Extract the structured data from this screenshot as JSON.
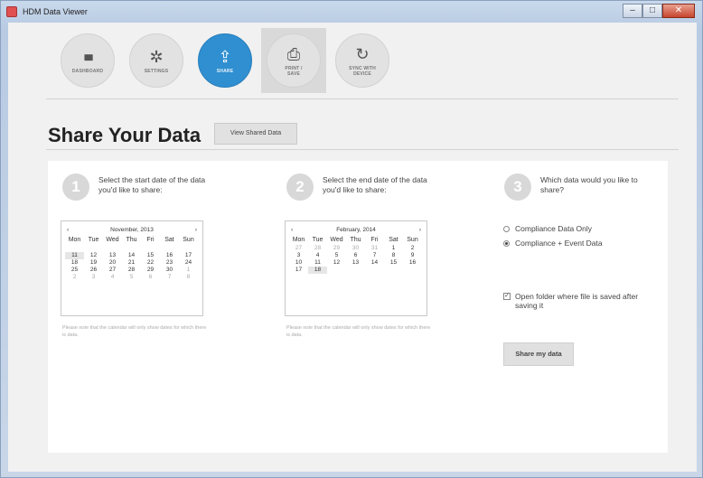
{
  "window": {
    "title": "HDM Data Viewer",
    "min": "–",
    "max": "□",
    "close": "✕"
  },
  "toolbar": {
    "items": [
      {
        "label": "DASHBOARD",
        "icon": "bar-chart-icon",
        "glyph": "▮▮▮"
      },
      {
        "label": "SETTINGS",
        "icon": "gear-icon",
        "glyph": "✲"
      },
      {
        "label": "SHARE",
        "icon": "upload-icon",
        "glyph": "⇪"
      },
      {
        "label": "PRINT / SAVE",
        "icon": "print-icon",
        "glyph": "⎙"
      },
      {
        "label": "SYNC WITH DEVICE",
        "icon": "sync-icon",
        "glyph": "↻"
      }
    ],
    "active_index": 2
  },
  "page": {
    "title": "Share Your Data",
    "view_shared_label": "View Shared Data"
  },
  "step1": {
    "number": "1",
    "text": "Select the start date of the data you'd like to share:"
  },
  "step2": {
    "number": "2",
    "text": "Select the end date of the data you'd like to share:"
  },
  "step3": {
    "number": "3",
    "text": "Which data would you like to share?"
  },
  "weekdays": [
    "Mon",
    "Tue",
    "Wed",
    "Thu",
    "Fri",
    "Sat",
    "Sun"
  ],
  "calendar1": {
    "month": "November, 2013",
    "prev": "‹",
    "next": "›",
    "rows": [
      [
        "",
        "",
        "",
        "",
        "",
        "",
        ""
      ],
      [
        "11",
        "12",
        "13",
        "14",
        "15",
        "16",
        "17"
      ],
      [
        "18",
        "19",
        "20",
        "21",
        "22",
        "23",
        "24"
      ],
      [
        "25",
        "26",
        "27",
        "28",
        "29",
        "30",
        "1"
      ],
      [
        "2",
        "3",
        "4",
        "5",
        "6",
        "7",
        "8"
      ]
    ],
    "selected": "11"
  },
  "calendar2": {
    "month": "February, 2014",
    "prev": "‹",
    "next": "›",
    "rows": [
      [
        "27",
        "28",
        "29",
        "30",
        "31",
        "1",
        "2"
      ],
      [
        "3",
        "4",
        "5",
        "6",
        "7",
        "8",
        "9"
      ],
      [
        "10",
        "11",
        "12",
        "13",
        "14",
        "15",
        "16"
      ],
      [
        "17",
        "18",
        "",
        "",
        "",
        "",
        ""
      ]
    ],
    "selected": "18"
  },
  "note": "Please note that the calendar will only show dates for which there is data.",
  "options": {
    "compliance_only": "Compliance Data Only",
    "compliance_event": "Compliance + Event Data",
    "selected": "compliance_event"
  },
  "open_folder": {
    "label": "Open folder where file is saved after saving it",
    "checked": true
  },
  "share_button": "Share my data"
}
